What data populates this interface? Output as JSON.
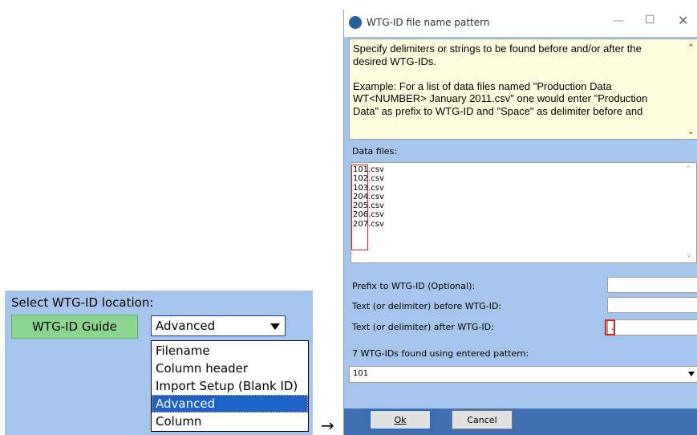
{
  "left": {
    "label": "Select WTG-ID location:",
    "guide_button": "WTG-ID Guide",
    "combo_value": "Advanced",
    "options": [
      "Filename",
      "Column header",
      "Import Setup (Blank ID)",
      "Advanced",
      "Column"
    ],
    "selected_option": "Advanced"
  },
  "arrow": "→",
  "dialog": {
    "title": "WTG-ID file name pattern",
    "help_paragraphs": [
      "Specify delimiters or strings to be found before and/or after the desired WTG-IDs.",
      "Example: For a list of data files named \"Production Data WT<NUMBER> January 2011.csv\" one would enter \"Production Data\" as prefix to WTG-ID and \"Space\" as delimiter before and"
    ],
    "data_files_label": "Data files:",
    "files": [
      {
        "id": "101",
        "ext": ".csv"
      },
      {
        "id": "102",
        "ext": ".csv"
      },
      {
        "id": "103",
        "ext": ".csv"
      },
      {
        "id": "204",
        "ext": ".csv"
      },
      {
        "id": "205",
        "ext": ".csv"
      },
      {
        "id": "206",
        "ext": ".csv"
      },
      {
        "id": "207",
        "ext": ".csv"
      }
    ],
    "prefix_label": "Prefix to WTG-ID (Optional):",
    "prefix_value": "",
    "before_label": "Text (or delimiter) before WTG-ID:",
    "before_value": "",
    "after_label": "Text (or delimiter) after WTG-ID:",
    "after_value": ".",
    "found_label": "7 WTG-IDs found using entered pattern:",
    "found_value": "101",
    "ok_button": "Ok",
    "cancel_button": "Cancel"
  },
  "colors": {
    "panel_bg": "#a6c5ec",
    "guide_button_bg": "#8cd58f",
    "selection": "#1e62c8",
    "highlight_border": "#e02020",
    "help_bg": "#ffffe0",
    "footer": "#3f6fb0"
  }
}
